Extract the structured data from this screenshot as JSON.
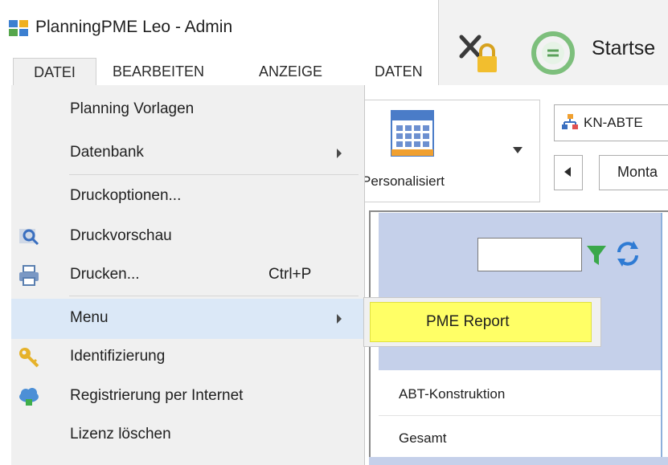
{
  "window": {
    "title": "PlanningPME Leo  - Admin"
  },
  "menubar": {
    "items": [
      "DATEI",
      "BEARBEITEN",
      "ANZEIGE",
      "DATEN"
    ]
  },
  "toolbar": {
    "start_label": "Startse"
  },
  "ribbon": {
    "view_label": "Personalisiert",
    "department_value": "KN-ABTE",
    "day_value": "Monta"
  },
  "grid": {
    "rows": [
      "ABT-Konstruktion",
      "Gesamt"
    ]
  },
  "file_menu": {
    "items": [
      {
        "label": "Planning Vorlagen",
        "shortcut": "",
        "submenu": false,
        "icon": ""
      },
      {
        "label": "Datenbank",
        "shortcut": "",
        "submenu": true,
        "icon": ""
      },
      {
        "label": "Druckoptionen...",
        "shortcut": "",
        "submenu": false,
        "icon": ""
      },
      {
        "label": "Druckvorschau",
        "shortcut": "",
        "submenu": false,
        "icon": "print-preview-icon"
      },
      {
        "label": "Drucken...",
        "shortcut": "Ctrl+P",
        "submenu": false,
        "icon": "printer-icon"
      },
      {
        "label": "Menu",
        "shortcut": "",
        "submenu": true,
        "icon": "",
        "highlighted": true
      },
      {
        "label": "Identifizierung",
        "shortcut": "",
        "submenu": false,
        "icon": "key-icon"
      },
      {
        "label": "Registrierung per Internet",
        "shortcut": "",
        "submenu": false,
        "icon": "cloud-icon"
      },
      {
        "label": "Lizenz löschen",
        "shortcut": "",
        "submenu": false,
        "icon": ""
      }
    ]
  },
  "submenu": {
    "items": [
      {
        "label": "PME Report",
        "highlighted": true
      }
    ]
  },
  "colors": {
    "menu_bg": "#f0f0f0",
    "menu_highlight": "#dbe8f7",
    "submenu_highlight": "#ffff66",
    "grid_header": "#c5d0ea"
  }
}
